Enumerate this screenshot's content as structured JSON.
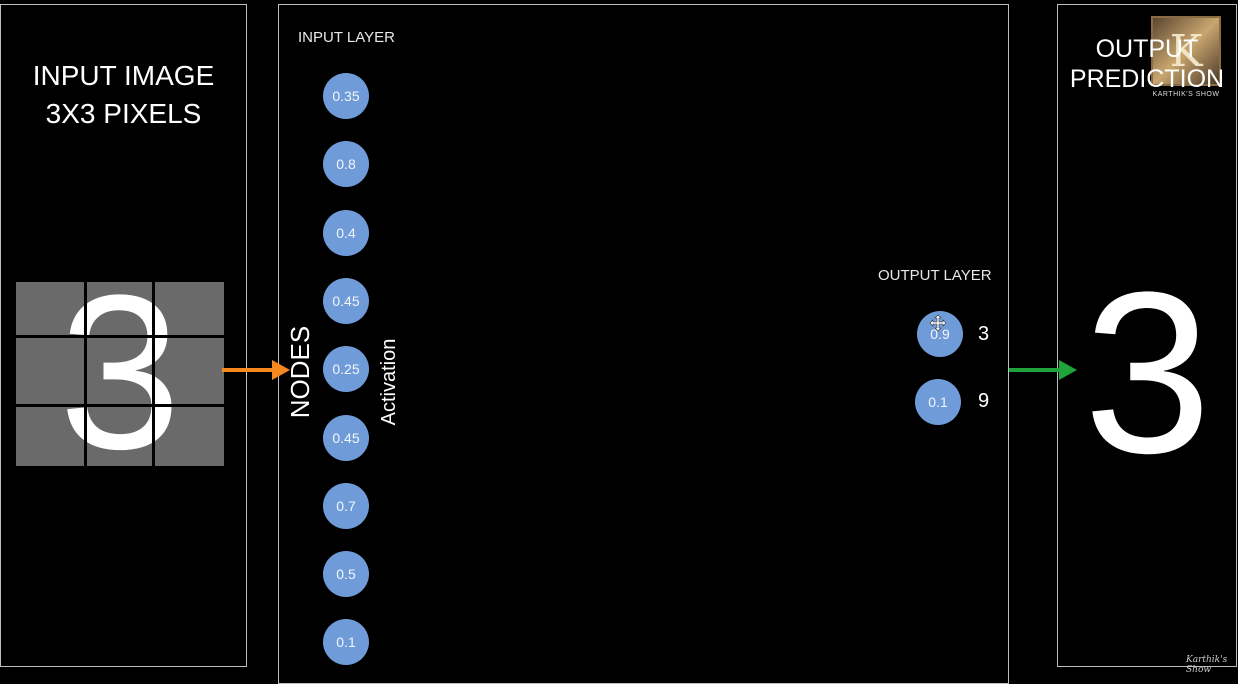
{
  "left_panel": {
    "title_line1": "INPUT IMAGE",
    "title_line2": "3X3 PIXELS",
    "digit": "3"
  },
  "middle_panel": {
    "input_layer_label": "INPUT LAYER",
    "nodes_label": "NODES",
    "activation_label": "Activation",
    "input_nodes": [
      "0.35",
      "0.8",
      "0.4",
      "0.45",
      "0.25",
      "0.45",
      "0.7",
      "0.5",
      "0.1"
    ],
    "output_layer_label": "OUTPUT LAYER",
    "output_nodes": [
      {
        "value": "0.9",
        "digit": "3"
      },
      {
        "value": "0.1",
        "digit": "9"
      }
    ]
  },
  "right_panel": {
    "title_line1": "OUTPUT",
    "title_line2": "PREDICTION",
    "digit": "3"
  },
  "branding": {
    "logo_letter": "K",
    "logo_text": "KARTHIK'S SHOW",
    "signature": "Karthik's Show"
  },
  "colors": {
    "node_fill": "#6f9bd8",
    "input_arrow": "#f5891f",
    "output_arrow": "#1fa33a",
    "pixel_gray": "#6a6a6a"
  }
}
